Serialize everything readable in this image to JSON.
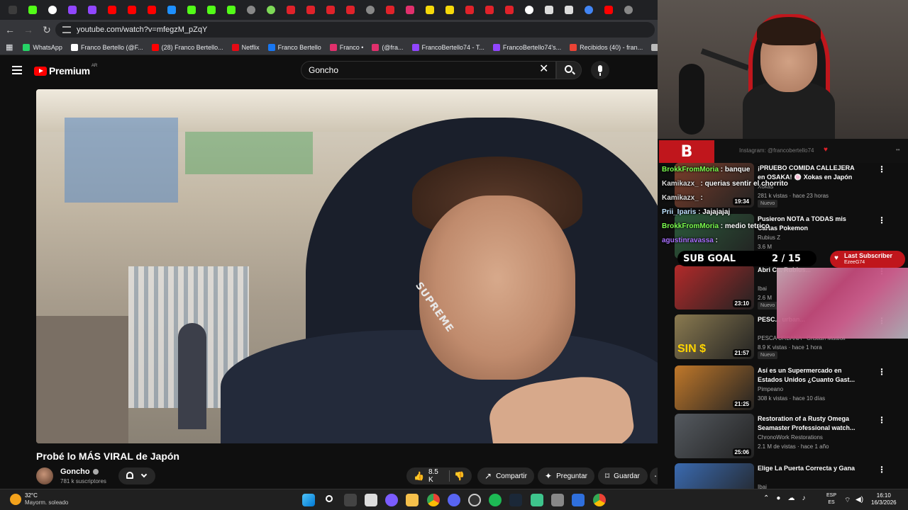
{
  "browser": {
    "url": "youtube.com/watch?v=mfegzM_pZqY",
    "bookmarks": [
      {
        "label": "WhatsApp",
        "color": "#25d366"
      },
      {
        "label": "Franco Bertello (@F...",
        "color": "#ffffff"
      },
      {
        "label": "(28) Franco Bertello...",
        "color": "#ff0000"
      },
      {
        "label": "Netflix",
        "color": "#e50914"
      },
      {
        "label": "Franco Bertello",
        "color": "#1877f2"
      },
      {
        "label": "Franco •",
        "color": "#e1306c"
      },
      {
        "label": "(@fra...",
        "color": "#e1306c"
      },
      {
        "label": "FrancoBertello74 - T...",
        "color": "#9146ff"
      },
      {
        "label": "FrancoBertello74's...",
        "color": "#9146ff"
      },
      {
        "label": "Recibidos (40) - fran...",
        "color": "#ea4335"
      },
      {
        "label": "outlook",
        "color": "#bbbbbb"
      },
      {
        "label": "Aler",
        "color": "#3ec48c"
      }
    ]
  },
  "youtube": {
    "logo_text": "Premium",
    "region_badge": "AR",
    "search_value": "Goncho"
  },
  "video": {
    "title": "Probé lo MÁS VIRAL de Japón",
    "hoodie_text": "SUPREME",
    "channel": "Goncho",
    "subscribers": "781 k suscriptores",
    "likes": "8.5 K",
    "share_label": "Compartir",
    "ask_label": "Preguntar",
    "save_label": "Guardar"
  },
  "stream": {
    "instagram": "Instagram: @francobertello74",
    "subgoal_label": "SUB GOAL",
    "subgoal_value": "2 / 15",
    "last_sub_label": "Last Subscriber",
    "last_sub_name": "EzeeG74",
    "chat": [
      {
        "user": "BrokkFromMoria",
        "color": "#7cff4f",
        "msg": "banque"
      },
      {
        "user": "Kamikazx_",
        "color": "#dddddd",
        "msg": "querias sentir el chorrito"
      },
      {
        "user": "Kamikazx_",
        "color": "#dddddd",
        "msg": ""
      },
      {
        "user": "Prii_Iparis",
        "color": "#bfe3ff",
        "msg": "Jajajajaj"
      },
      {
        "user": "BrokkFromMoria",
        "color": "#7cff4f",
        "msg": "medio tetrico"
      },
      {
        "user": "agustinravassa",
        "color": "#a970ff",
        "msg": ""
      }
    ]
  },
  "recommendations": [
    {
      "title": "¡PRUEBO COMIDA CALLEJERA en OSAKA! 🍥 Xokas en Japón",
      "channel": "Xokas",
      "meta": "281 k vistas · hace 23 horas",
      "duration": "19:34",
      "badge": "Nuevo",
      "thumb": "#7a3d2a"
    },
    {
      "title": "Pusieron NOTA a TODAS mis Cartas Pokemon",
      "channel": "Rubius Z",
      "meta": "3.6 M",
      "duration": "",
      "badge": "",
      "thumb": "#2b5a3a"
    },
    {
      "title": "Abri C... Rubius...",
      "channel": "Ibai",
      "meta": "2.6 M",
      "duration": "23:10",
      "badge": "Nuevo",
      "thumb": "#b32a2a"
    },
    {
      "title": "PESC... urban...",
      "channel": "PESCA URBANA - Cristian Mattioli",
      "meta": "8.9 K vistas · hace 1 hora",
      "duration": "21:57",
      "badge": "Nuevo",
      "thumb": "#8a7a50",
      "thumb_text": "SIN $"
    },
    {
      "title": "Así es un Supermercado en Estados Unidos ¿Cuanto Gast...",
      "channel": "Pimpeano",
      "meta": "308 k vistas · hace 10 días",
      "duration": "21:25",
      "badge": "",
      "thumb": "#c0782a"
    },
    {
      "title": "Restoration of a Rusty Omega Seamaster Professional watch...",
      "channel": "ChronoWork Restorations",
      "meta": "2.1 M de vistas · hace 1 año",
      "duration": "25:06",
      "badge": "",
      "thumb": "#555a60"
    },
    {
      "title": "Elige La Puerta Correcta y Gana",
      "channel": "Ibai",
      "meta": "3.7 M de vistas · hace 2 semanas",
      "duration": "",
      "badge": "",
      "thumb": "#3a6ab0"
    }
  ],
  "taskbar": {
    "temperature": "32°C",
    "weather": "Mayorm. soleado",
    "lang_top": "ESP",
    "lang_bottom": "ES",
    "time": "16:10",
    "date": "16/3/2026"
  }
}
